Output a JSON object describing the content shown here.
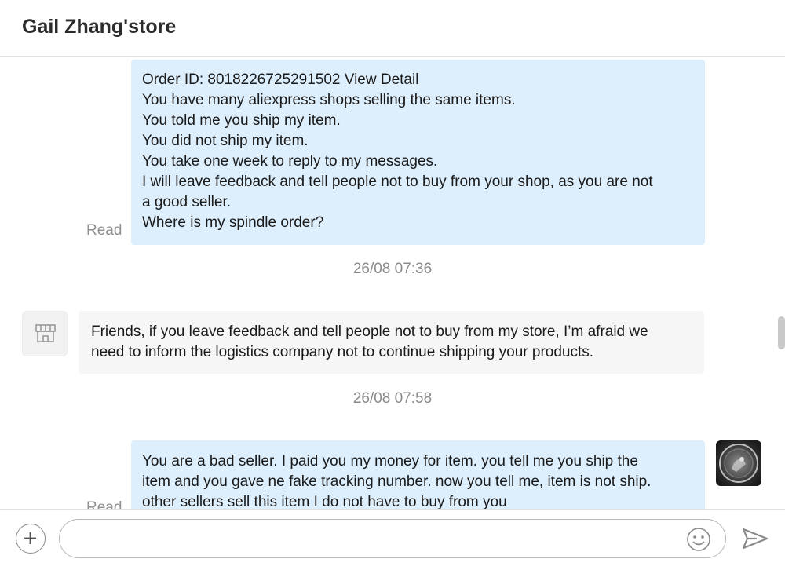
{
  "header": {
    "title": "Gail Zhang'store"
  },
  "messages": [
    {
      "type": "outgoing",
      "status": "Read",
      "lines": [
        "Order ID: 8018226725291502 View Detail",
        "You have many aliexpress shops selling the same items.",
        "You told me you ship my item.",
        "You did not ship my item.",
        "You take one week to reply to my messages.",
        "I will leave feedback and tell people not to buy from your shop, as you are not",
        "a good seller.",
        "Where is my spindle order?"
      ]
    },
    {
      "type": "timestamp",
      "text": "26/08 07:36"
    },
    {
      "type": "incoming",
      "lines": [
        "Friends, if you leave feedback and tell people not to buy from my store, I’m afraid we",
        "need to inform the logistics company not to continue shipping your products."
      ]
    },
    {
      "type": "timestamp",
      "text": "26/08 07:58"
    },
    {
      "type": "outgoing",
      "status": "Read",
      "lines": [
        "You are a bad seller. I paid you my money for item. you tell me you ship the",
        "item and you gave ne fake tracking number. now you tell me, item is not ship.",
        "other sellers sell this item I do not have to buy from you"
      ]
    }
  ],
  "composer": {
    "placeholder": "",
    "value": ""
  },
  "icons": {
    "add": "plus-circle-icon",
    "emoji": "smiley-icon",
    "send": "send-arrow-icon",
    "shop_avatar": "store-icon",
    "user_avatar": "user-avatar-image"
  },
  "colors": {
    "outgoing_bubble": "#ddeefc",
    "incoming_bubble": "#f6f6f6",
    "muted_text": "#8a8a8a"
  }
}
